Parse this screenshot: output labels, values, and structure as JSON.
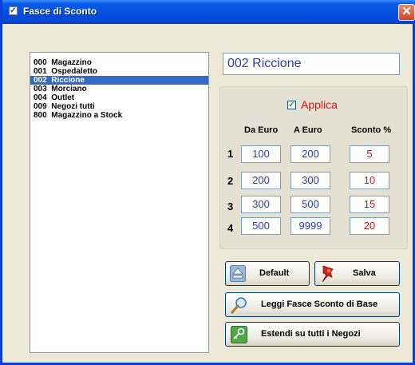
{
  "window": {
    "title": "Fasce di Sconto",
    "title_checkbox_icon": "checkbox-checked-icon",
    "close_icon": "close-icon"
  },
  "stores": [
    {
      "label": "000  Magazzino",
      "selected": false
    },
    {
      "label": "001  Ospedaletto",
      "selected": false
    },
    {
      "label": "002  Riccione",
      "selected": true
    },
    {
      "label": "003  Morciano",
      "selected": false
    },
    {
      "label": "004  Outlet",
      "selected": false
    },
    {
      "label": "009  Negozi tutti",
      "selected": false
    },
    {
      "label": "800  Magazzino a Stock",
      "selected": false
    }
  ],
  "selected_store": "002 Riccione",
  "discount_panel": {
    "applica_label": "Applica",
    "applica_checked": true,
    "header_da": "Da Euro",
    "header_a": "A Euro",
    "header_sconto": "Sconto %",
    "rows": [
      {
        "num": "1",
        "da": "100",
        "a": "200",
        "sconto": "5"
      },
      {
        "num": "2",
        "da": "200",
        "a": "300",
        "sconto": "10"
      },
      {
        "num": "3",
        "da": "300",
        "a": "500",
        "sconto": "15"
      },
      {
        "num": "4",
        "da": "500",
        "a": "9999",
        "sconto": "20"
      }
    ]
  },
  "buttons": {
    "default_label": "Default",
    "salva_label": "Salva",
    "leggi_label": "Leggi Fasce Sconto di Base",
    "estendi_label": "Estendi su tutti i Negozi"
  },
  "colors": {
    "title_bar": "#0350df",
    "selection": "#316ac5",
    "applica": "#e81010",
    "value_blue": "#2a3ea8",
    "value_red": "#c01c1c"
  }
}
